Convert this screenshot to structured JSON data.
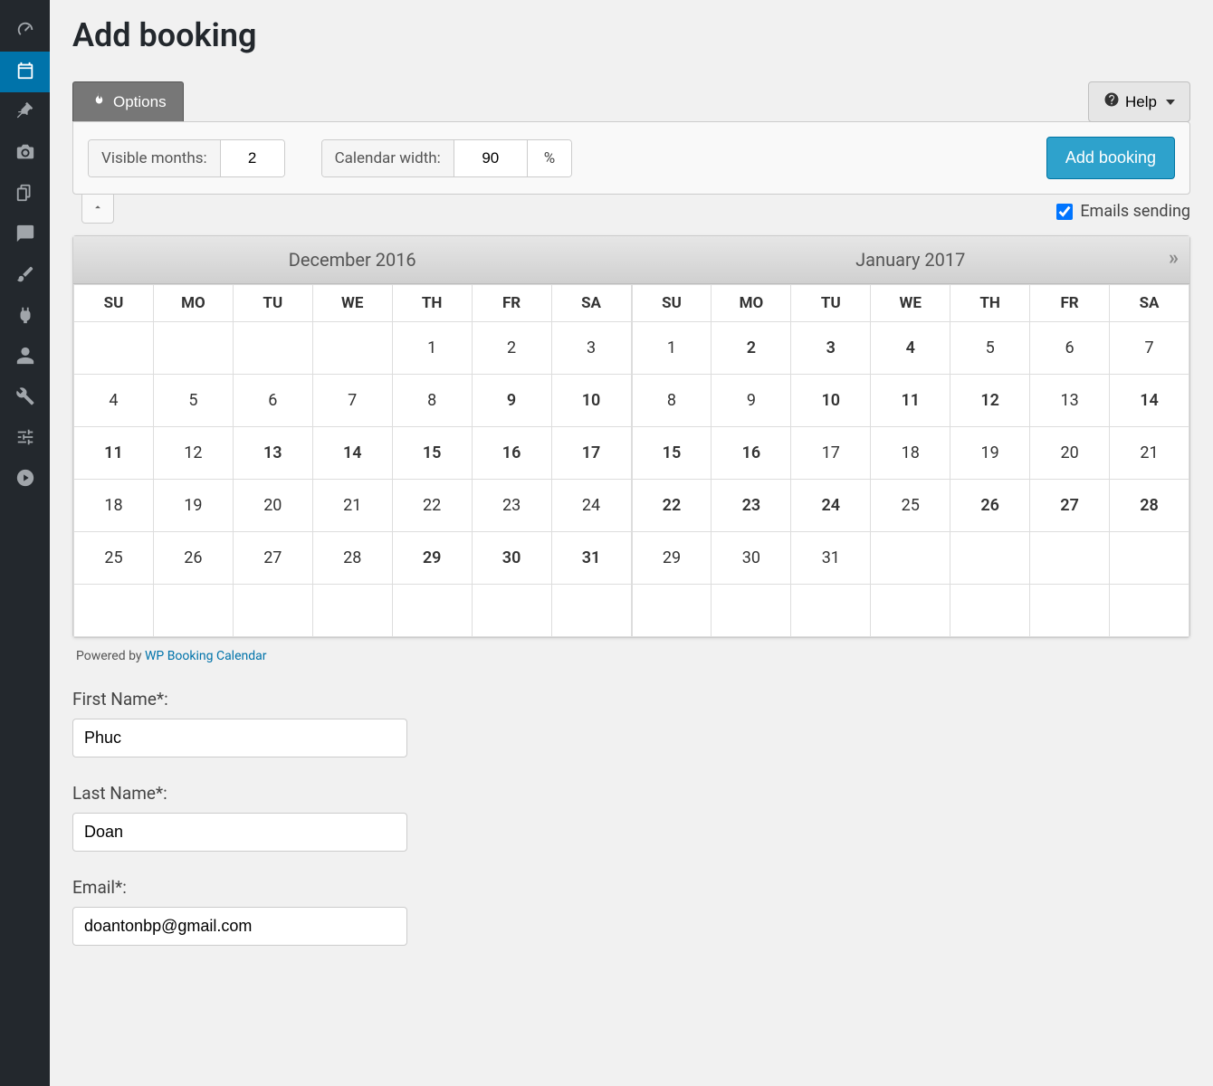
{
  "page": {
    "title": "Add booking"
  },
  "tabs": {
    "options_label": "Options",
    "help_label": "Help"
  },
  "options": {
    "visible_months_label": "Visible months:",
    "visible_months_value": "2",
    "calendar_width_label": "Calendar width:",
    "calendar_width_value": "90",
    "calendar_width_unit": "%",
    "add_booking_button": "Add booking"
  },
  "emails": {
    "label": "Emails sending",
    "checked": true
  },
  "calendar": {
    "weekdays": [
      "SU",
      "MO",
      "TU",
      "WE",
      "TH",
      "FR",
      "SA"
    ],
    "months": [
      {
        "label": "December 2016",
        "rows": [
          [
            {
              "d": "",
              "s": "empty"
            },
            {
              "d": "",
              "s": "empty"
            },
            {
              "d": "",
              "s": "empty"
            },
            {
              "d": "",
              "s": "empty"
            },
            {
              "d": "1",
              "s": ""
            },
            {
              "d": "2",
              "s": ""
            },
            {
              "d": "3",
              "s": ""
            }
          ],
          [
            {
              "d": "4",
              "s": ""
            },
            {
              "d": "5",
              "s": ""
            },
            {
              "d": "6",
              "s": ""
            },
            {
              "d": "7",
              "s": "muted"
            },
            {
              "d": "8",
              "s": "muted"
            },
            {
              "d": "9",
              "s": "red"
            },
            {
              "d": "10",
              "s": "red"
            }
          ],
          [
            {
              "d": "11",
              "s": "red"
            },
            {
              "d": "12",
              "s": "muted"
            },
            {
              "d": "13",
              "s": "dark"
            },
            {
              "d": "14",
              "s": "dark"
            },
            {
              "d": "15",
              "s": "dark"
            },
            {
              "d": "16",
              "s": "dark"
            },
            {
              "d": "17",
              "s": "dark"
            }
          ],
          [
            {
              "d": "18",
              "s": "muted"
            },
            {
              "d": "19",
              "s": "muted"
            },
            {
              "d": "20",
              "s": "muted"
            },
            {
              "d": "21",
              "s": "muted"
            },
            {
              "d": "22",
              "s": "muted"
            },
            {
              "d": "23",
              "s": "muted"
            },
            {
              "d": "24",
              "s": "muted"
            }
          ],
          [
            {
              "d": "25",
              "s": "muted"
            },
            {
              "d": "26",
              "s": "muted"
            },
            {
              "d": "27",
              "s": "muted"
            },
            {
              "d": "28",
              "s": "muted"
            },
            {
              "d": "29",
              "s": "red"
            },
            {
              "d": "30",
              "s": "red"
            },
            {
              "d": "31",
              "s": "red"
            }
          ],
          [
            {
              "d": "",
              "s": "empty"
            },
            {
              "d": "",
              "s": "empty"
            },
            {
              "d": "",
              "s": "empty"
            },
            {
              "d": "",
              "s": "empty"
            },
            {
              "d": "",
              "s": "empty"
            },
            {
              "d": "",
              "s": "empty"
            },
            {
              "d": "",
              "s": "empty"
            }
          ]
        ]
      },
      {
        "label": "January 2017",
        "rows": [
          [
            {
              "d": "1",
              "s": "muted"
            },
            {
              "d": "2",
              "s": "orange"
            },
            {
              "d": "3",
              "s": "orange"
            },
            {
              "d": "4",
              "s": "orange"
            },
            {
              "d": "5",
              "s": "muted"
            },
            {
              "d": "6",
              "s": "muted"
            },
            {
              "d": "7",
              "s": "muted"
            }
          ],
          [
            {
              "d": "8",
              "s": "muted"
            },
            {
              "d": "9",
              "s": "muted"
            },
            {
              "d": "10",
              "s": "orange"
            },
            {
              "d": "11",
              "s": "orange"
            },
            {
              "d": "12",
              "s": "orange"
            },
            {
              "d": "13",
              "s": "muted"
            },
            {
              "d": "14",
              "s": "red"
            }
          ],
          [
            {
              "d": "15",
              "s": "red"
            },
            {
              "d": "16",
              "s": "red"
            },
            {
              "d": "17",
              "s": "muted"
            },
            {
              "d": "18",
              "s": "muted"
            },
            {
              "d": "19",
              "s": "muted"
            },
            {
              "d": "20",
              "s": "muted"
            },
            {
              "d": "21",
              "s": "muted"
            }
          ],
          [
            {
              "d": "22",
              "s": "orange"
            },
            {
              "d": "23",
              "s": "orange"
            },
            {
              "d": "24",
              "s": "orange"
            },
            {
              "d": "25",
              "s": "muted"
            },
            {
              "d": "26",
              "s": "orange"
            },
            {
              "d": "27",
              "s": "orange"
            },
            {
              "d": "28",
              "s": "orange"
            }
          ],
          [
            {
              "d": "29",
              "s": "muted"
            },
            {
              "d": "30",
              "s": "muted"
            },
            {
              "d": "31",
              "s": "muted"
            },
            {
              "d": "",
              "s": "empty"
            },
            {
              "d": "",
              "s": "empty"
            },
            {
              "d": "",
              "s": "empty"
            },
            {
              "d": "",
              "s": "empty"
            }
          ],
          [
            {
              "d": "",
              "s": "empty"
            },
            {
              "d": "",
              "s": "empty"
            },
            {
              "d": "",
              "s": "empty"
            },
            {
              "d": "",
              "s": "empty"
            },
            {
              "d": "",
              "s": "empty"
            },
            {
              "d": "",
              "s": "empty"
            },
            {
              "d": "",
              "s": "empty"
            }
          ]
        ]
      }
    ]
  },
  "powered": {
    "prefix": "Powered by ",
    "link_text": "WP Booking Calendar"
  },
  "form": {
    "first_name_label": "First Name*:",
    "first_name_value": "Phuc",
    "last_name_label": "Last Name*:",
    "last_name_value": "Doan",
    "email_label": "Email*:",
    "email_value": "doantonbp@gmail.com"
  },
  "sidebar_icons": [
    "dashboard",
    "booking",
    "pin",
    "media",
    "pages",
    "comments",
    "brush",
    "plug",
    "user",
    "wrench",
    "settings",
    "play"
  ]
}
